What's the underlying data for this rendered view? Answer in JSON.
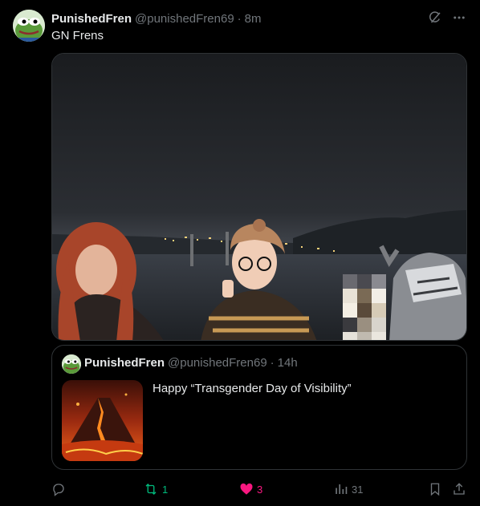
{
  "tweet": {
    "author": {
      "display_name": "PunishedFren",
      "handle": "@punishedFren69",
      "time": "8m"
    },
    "text": "GN Frens",
    "media": {
      "description_icon": "photo"
    },
    "quote": {
      "author": {
        "display_name": "PunishedFren",
        "handle": "@punishedFren69",
        "time": "14h"
      },
      "text": "Happy “Transgender Day of Visibility”"
    },
    "stats": {
      "replies": "",
      "retweets": "1",
      "likes": "3",
      "views": "31"
    }
  },
  "ui": {
    "separator": "·",
    "colors": {
      "background": "#000000",
      "text": "#e7e9ea",
      "muted": "#71767b",
      "border": "#2f3336",
      "retweet_green": "#00ba7c",
      "like_pink": "#f91880"
    },
    "icons": [
      "grok-icon",
      "more-icon",
      "reply-icon",
      "retweet-icon",
      "like-icon",
      "views-icon",
      "bookmark-icon",
      "share-icon"
    ]
  }
}
